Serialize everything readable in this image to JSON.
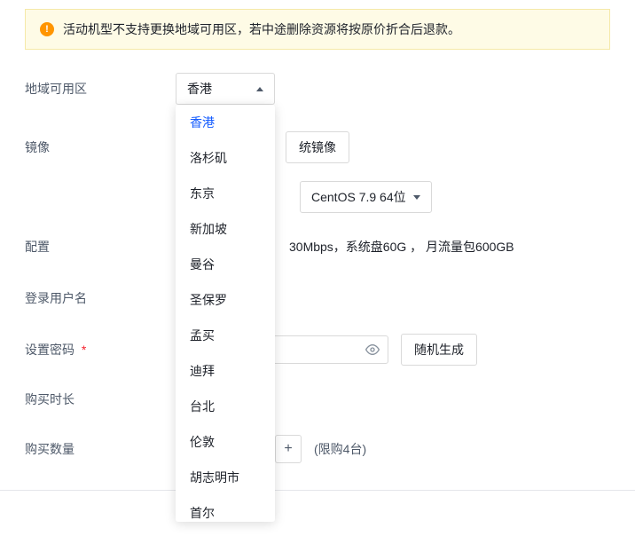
{
  "alert": {
    "message": "活动机型不支持更换地域可用区，若中途删除资源将按原价折合后退款。"
  },
  "labels": {
    "region": "地域可用区",
    "image": "镜像",
    "config": "配置",
    "loginUser": "登录用户名",
    "setPassword": "设置密码",
    "duration": "购买时长",
    "quantity": "购买数量"
  },
  "region": {
    "selected": "香港",
    "options": [
      "香港",
      "洛杉矶",
      "东京",
      "新加坡",
      "曼谷",
      "圣保罗",
      "孟买",
      "迪拜",
      "台北",
      "伦敦",
      "胡志明市",
      "首尔"
    ]
  },
  "image": {
    "sysImageBtn": "统镜像",
    "osSelected": "CentOS 7.9 64位"
  },
  "config": {
    "text": "30Mbps，系统盘60G ， 月流量包600GB"
  },
  "password": {
    "randomBtn": "随机生成",
    "value": ""
  },
  "quantity": {
    "plus": "+",
    "limitText": "(限购4台)"
  }
}
